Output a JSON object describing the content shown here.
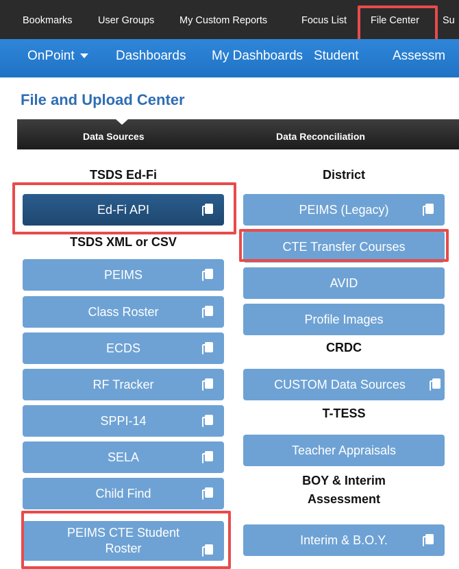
{
  "topbar": {
    "items": [
      "Bookmarks",
      "User Groups",
      "My Custom Reports",
      "Focus List",
      "File Center",
      "Su"
    ]
  },
  "navbar": {
    "items": [
      "OnPoint",
      "Dashboards",
      "My Dashboards",
      "Student",
      "Assessm"
    ]
  },
  "page": {
    "title": "File and Upload Center"
  },
  "tabs": [
    "Data Sources",
    "Data Reconciliation"
  ],
  "left": {
    "tsds_edfi_header": "TSDS Ed-Fi",
    "edfi_api": "Ed-Fi API",
    "tsds_xml_header": "TSDS XML or CSV",
    "buttons": [
      "PEIMS",
      "Class Roster",
      "ECDS",
      "RF Tracker",
      "SPPI-14",
      "SELA",
      "Child Find"
    ],
    "cte_roster_line1": "PEIMS CTE Student",
    "cte_roster_line2": "Roster"
  },
  "right": {
    "district_header": "District",
    "peims_legacy": "PEIMS (Legacy)",
    "cte_transfer": "CTE Transfer Courses",
    "avid": "AVID",
    "profile_images": "Profile Images",
    "crdc_header": "CRDC",
    "custom_sources": "CUSTOM Data Sources",
    "ttess_header": "T-TESS",
    "teacher_appraisals": "Teacher Appraisals",
    "boy_header_line1": "BOY & Interim",
    "boy_header_line2": "Assessment",
    "interim_boy": "Interim & B.O.Y."
  },
  "colors": {
    "accent": "#1f73c5",
    "button": "#6ea2d4",
    "button_dark": "#1e476f",
    "highlight": "#e84b4b",
    "title": "#2f6db3"
  }
}
